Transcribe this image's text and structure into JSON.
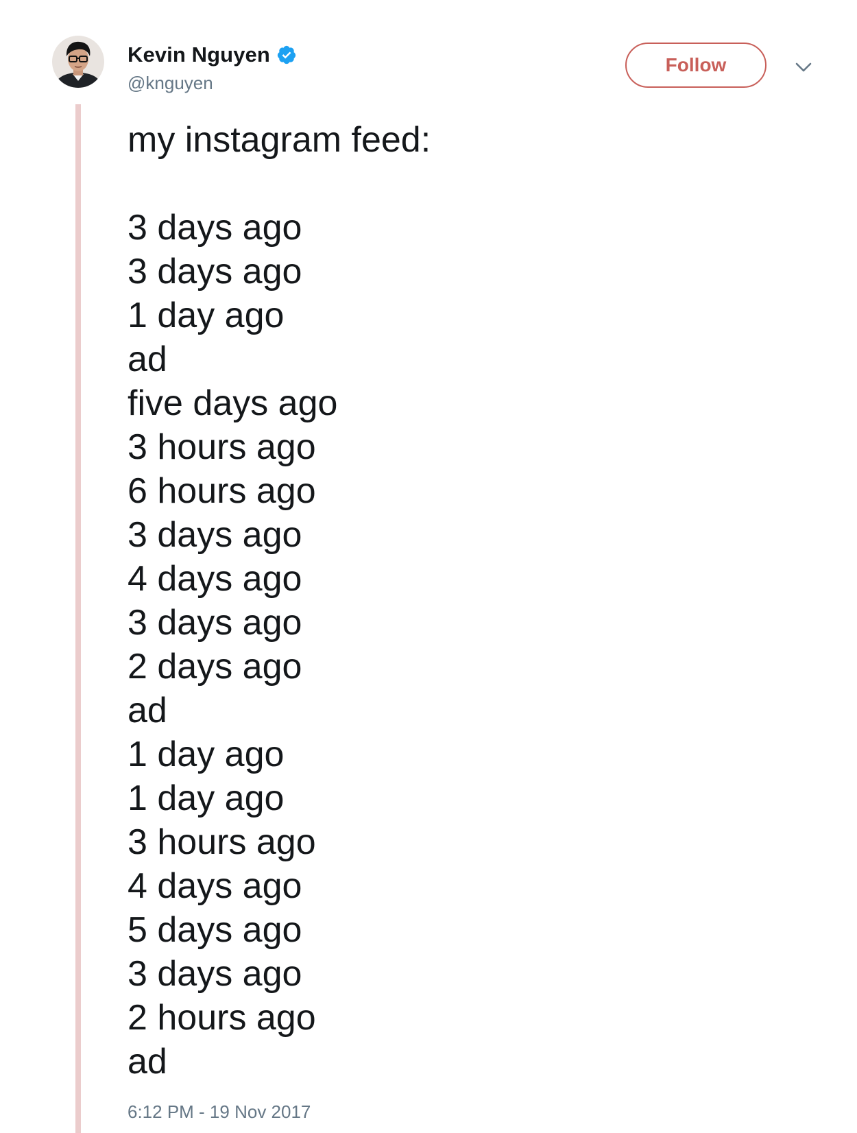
{
  "author": {
    "display_name": "Kevin Nguyen",
    "handle": "@knguyen",
    "verified": true
  },
  "actions": {
    "follow_label": "Follow"
  },
  "tweet": {
    "first_line": "my instagram feed:",
    "lines": [
      "3 days ago",
      "3 days ago",
      "1 day ago",
      "ad",
      "five days ago",
      "3 hours ago",
      "6 hours ago",
      "3 days ago",
      "4 days ago",
      "3 days ago",
      "2 days ago",
      "ad",
      "1 day ago",
      "1 day ago",
      "3 hours ago",
      "4 days ago",
      "5 days ago",
      "3 days ago",
      "2 hours ago",
      "ad"
    ],
    "timestamp": "6:12 PM - 19 Nov 2017"
  },
  "icons": {
    "verified": "verified-badge-icon",
    "chevron": "chevron-down-icon"
  },
  "colors": {
    "accent": "#c85f59",
    "verified_blue": "#1da1f2",
    "secondary_text": "#657786",
    "thread_line": "#ebcccc",
    "primary_text": "#14171a"
  }
}
